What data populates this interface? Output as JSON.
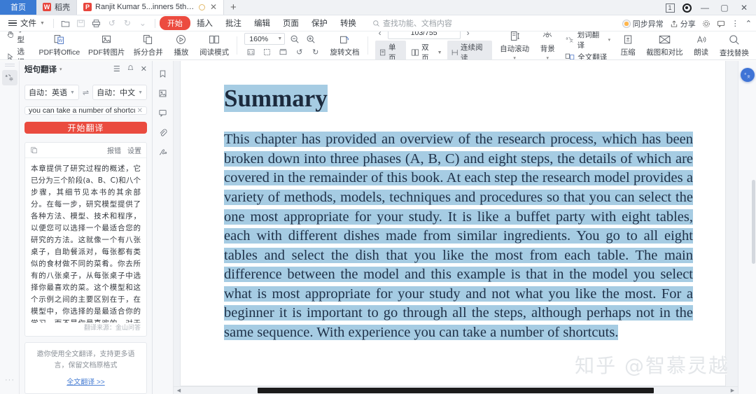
{
  "titlebar": {
    "tabs": [
      {
        "label": "首页",
        "type": "home",
        "icon": "home-icon"
      },
      {
        "label": "稻壳",
        "type": "normal",
        "icon": "wps-icon"
      },
      {
        "label": "Ranjit Kumar 5...inners 5th.pdf",
        "type": "active",
        "icon": "pdf-icon"
      }
    ],
    "new_tab_label": "+",
    "right_icons": {
      "count_badge": "1",
      "target_icon": "record-icon",
      "minimize": "—",
      "maximize": "▢",
      "close": "✕"
    }
  },
  "menubar": {
    "file_label": "文件",
    "items": [
      {
        "label": "开始",
        "active": true
      },
      {
        "label": "插入",
        "active": false
      },
      {
        "label": "批注",
        "active": false
      },
      {
        "label": "编辑",
        "active": false
      },
      {
        "label": "页面",
        "active": false
      },
      {
        "label": "保护",
        "active": false
      },
      {
        "label": "转换",
        "active": false
      }
    ],
    "search_placeholder": "查找功能、文档内容",
    "quick_icons": [
      "open-folder-icon",
      "save-icon",
      "print-icon",
      "undo-icon",
      "redo-icon",
      "customize-icon"
    ],
    "right": {
      "sync_label": "同步异常",
      "share_label": "分享",
      "settings_icon": "gear-icon",
      "feedback_icon": "comment-icon",
      "more_icon": "more-icon",
      "collapse_icon": "chevron-up-icon"
    }
  },
  "ribbon": {
    "hand_label": "手型",
    "select_label": "选择",
    "tools": [
      {
        "label": "PDF转Office",
        "icon": "pdf-to-office-icon",
        "has_caret": true
      },
      {
        "label": "PDF转图片",
        "icon": "pdf-to-image-icon",
        "has_caret": false
      },
      {
        "label": "拆分合并",
        "icon": "split-merge-icon",
        "has_caret": true
      },
      {
        "label": "播放",
        "icon": "play-icon",
        "has_caret": false
      },
      {
        "label": "阅读模式",
        "icon": "read-mode-icon",
        "has_caret": false
      }
    ],
    "zoom_value": "160%",
    "zoom_out_icon": "zoom-out-icon",
    "zoom_in_icon": "zoom-in-icon",
    "fit_icons": [
      "fit-actual-icon",
      "fit-page-icon",
      "fit-width-icon",
      "rotate-left-icon",
      "rotate-right-icon"
    ],
    "rotate_label": "旋转文档",
    "page_value": "103/755",
    "prev_page_icon": "chevron-left-icon",
    "next_page_icon": "chevron-right-icon",
    "view_modes": [
      {
        "label": "单页",
        "icon": "single-page-icon",
        "selected": true
      },
      {
        "label": "双页",
        "icon": "double-page-icon",
        "selected": false,
        "has_caret": true
      },
      {
        "label": "连续阅读",
        "icon": "continuous-icon",
        "selected": true
      }
    ],
    "autoscroll_label": "自动滚动",
    "background_label": "背景",
    "translate_word_label": "划词翻译",
    "translate_full_label": "全文翻译",
    "compress_label": "压缩",
    "compare_label": "截图和对比",
    "read_aloud_label": "朗读",
    "find_replace_label": "查找替换"
  },
  "left_rail": {
    "translate_button_icon": "translate-icon",
    "more_dots": "···"
  },
  "translate_panel": {
    "title": "短句翻译",
    "title_caret": "▾",
    "header_icons": [
      "list-icon",
      "bell-icon",
      "close-icon"
    ],
    "source_lang": "自动：英语",
    "target_lang": "自动：中文",
    "swap_icon": "swap-icon",
    "input_value": "you can take a number of shortcuts.",
    "input_clear_icon": "clear-icon",
    "translate_button": "开始翻译",
    "result_copy_icon": "copy-icon",
    "result_report_label": "报错",
    "result_settings_label": "设置",
    "result_text": "本章提供了研究过程的概述，它已分为三个阶段(a、B、C)和八个步骤，其细节见本书的其余部分。在每一步，研究模型提供了各种方法、模型、技术和程序，以便您可以选择一个最适合您的研究的方法。这就像一个有八张桌子，自助餐派对，每张都有类似的食材做不同的菜肴。你去所有的八张桌子，从每张桌子中选择你最喜欢的菜。这个模型和这个示例之间的主要区别在于，在模型中，你选择的是最适合你的学习，而不是你最喜欢的。对于一个初学者来说，完成所有的步骤是很重要的，尽管可能不是在相同的顺序中。有了经验，你可以采取许多快捷方式。",
    "result_source": "翻译来源：金山问答",
    "promo_text": "邀你使用全文翻译，支持更多语言，保留文档原格式",
    "promo_link": "全文翻译 >>"
  },
  "doc_rail": {
    "icons": [
      "bookmark-icon",
      "thumbnail-icon",
      "comment-icon",
      "attachment-icon",
      "signature-icon"
    ]
  },
  "document": {
    "heading": "Summary",
    "paragraph": "This chapter has provided an overview of the research process, which has been broken down into three phases (A, B, C) and eight steps, the details of which are covered in the remainder of this book. At each step the research model provides a variety of methods, models, techniques and procedures so that you can select the one most appropriate for your study. It is like a buffet party with eight tables, each with different dishes made from similar ingredients. You go to all eight tables and select the dish that you like the most from each table. The main difference between the model and this example is that in the model you select what is most appropriate for your study and not what you like the most. For a beginner it is important to go through all the steps, although perhaps not in the same sequence. With experience you can take a number of shortcuts.",
    "watermark": "知乎 @智慕灵越"
  },
  "right_rail": {
    "fab_icon": "wps-ai-icon"
  },
  "colors": {
    "accent_red": "#ea4b3f",
    "selection_blue": "#a6cce3",
    "home_tab_blue": "#3b7bd4",
    "link_blue": "#4a7fd4",
    "fab_blue": "#3f74d6"
  }
}
